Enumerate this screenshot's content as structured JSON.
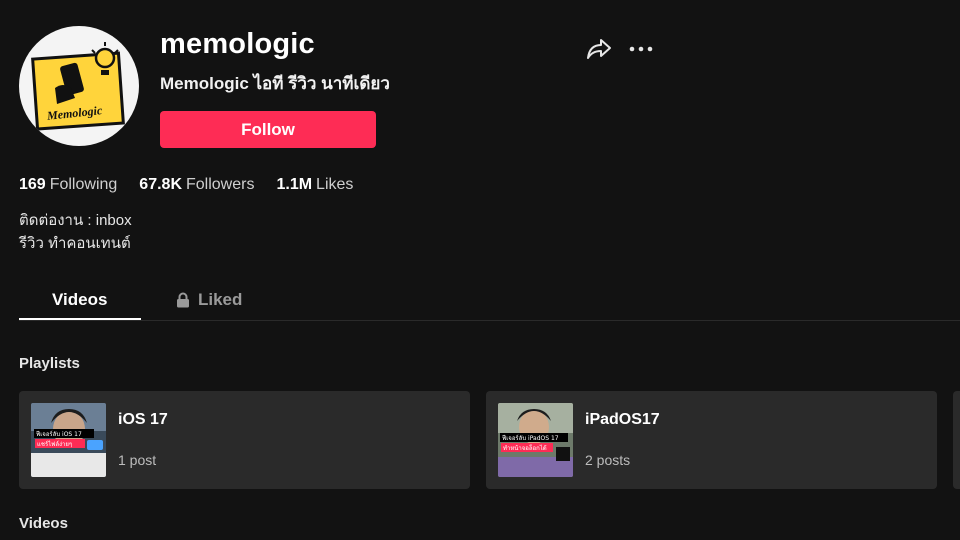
{
  "profile": {
    "username": "memologic",
    "nickname": "Memologic ไอที รีวิว นาทีเดียว",
    "avatar_text": "Memologic",
    "follow_label": "Follow",
    "bio": [
      "ติดต่องาน : inbox",
      "รีวิว ทำคอนเทนต์"
    ]
  },
  "stats": [
    {
      "value": "169",
      "label": "Following"
    },
    {
      "value": "67.8K",
      "label": "Followers"
    },
    {
      "value": "1.1M",
      "label": "Likes"
    }
  ],
  "tabs": {
    "videos": "Videos",
    "liked": "Liked"
  },
  "sections": {
    "playlists": "Playlists",
    "videos": "Videos"
  },
  "playlists": [
    {
      "title": "iOS 17",
      "count": "1 post",
      "thumb_line1": "ฟีเจอร์ลับ iOS 17",
      "thumb_line2": "แชร์ไฟล์ง่ายๆ"
    },
    {
      "title": "iPadOS17",
      "count": "2 posts",
      "thumb_line1": "ฟีเจอร์ลับ iPadOS 17",
      "thumb_line2": "ทำหน้าจอล็อกได้"
    }
  ],
  "colors": {
    "background": "#121212",
    "accent": "#fe2c55",
    "card": "#2a2a2a"
  },
  "icons": [
    "share-icon",
    "more-icon",
    "lock-icon"
  ]
}
